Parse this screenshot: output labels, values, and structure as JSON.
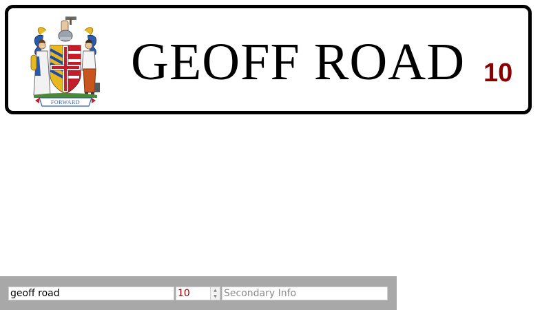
{
  "sign": {
    "street_name": "GEOFF ROAD",
    "house_number": "10",
    "crest_icon": "birmingham-coat-of-arms",
    "crest_motto": "FORWARD",
    "number_color": "#8b0000",
    "border_color": "#000000",
    "background_color": "#ffffff"
  },
  "controls": {
    "street_value": "geoff road",
    "number_value": "10",
    "number_color": "#8b0000",
    "secondary_placeholder": "Secondary Info",
    "secondary_value": "",
    "bar_color": "#a8a8a8"
  }
}
